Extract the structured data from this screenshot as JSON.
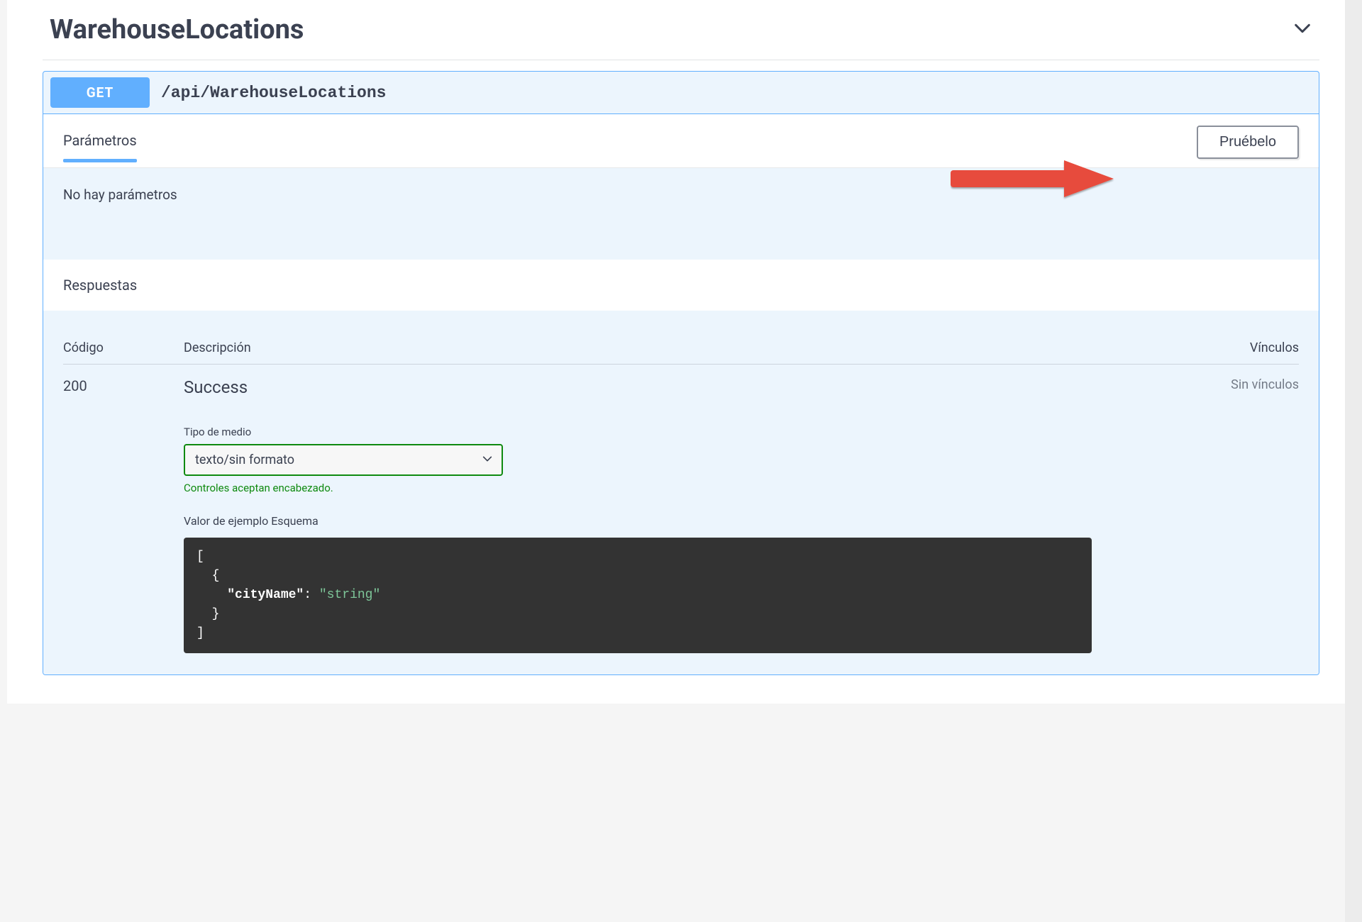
{
  "section": {
    "title": "WarehouseLocations"
  },
  "operation": {
    "method": "GET",
    "path": "/api/WarehouseLocations"
  },
  "tabs": {
    "params_label": "Parámetros"
  },
  "try_button": "Pruébelo",
  "params": {
    "empty_message": "No hay parámetros"
  },
  "responses": {
    "section_label": "Respuestas",
    "head_code": "Código",
    "head_desc": "Descripción",
    "head_links": "Vínculos",
    "rows": [
      {
        "code": "200",
        "description_title": "Success",
        "links": "Sin vínculos"
      }
    ]
  },
  "media": {
    "label": "Tipo de medio",
    "selected": "texto/sin formato",
    "accept_note": "Controles aceptan encabezado."
  },
  "example": {
    "label": "Valor de ejemplo Esquema",
    "json_key": "\"cityName\"",
    "json_value": "\"string\""
  }
}
